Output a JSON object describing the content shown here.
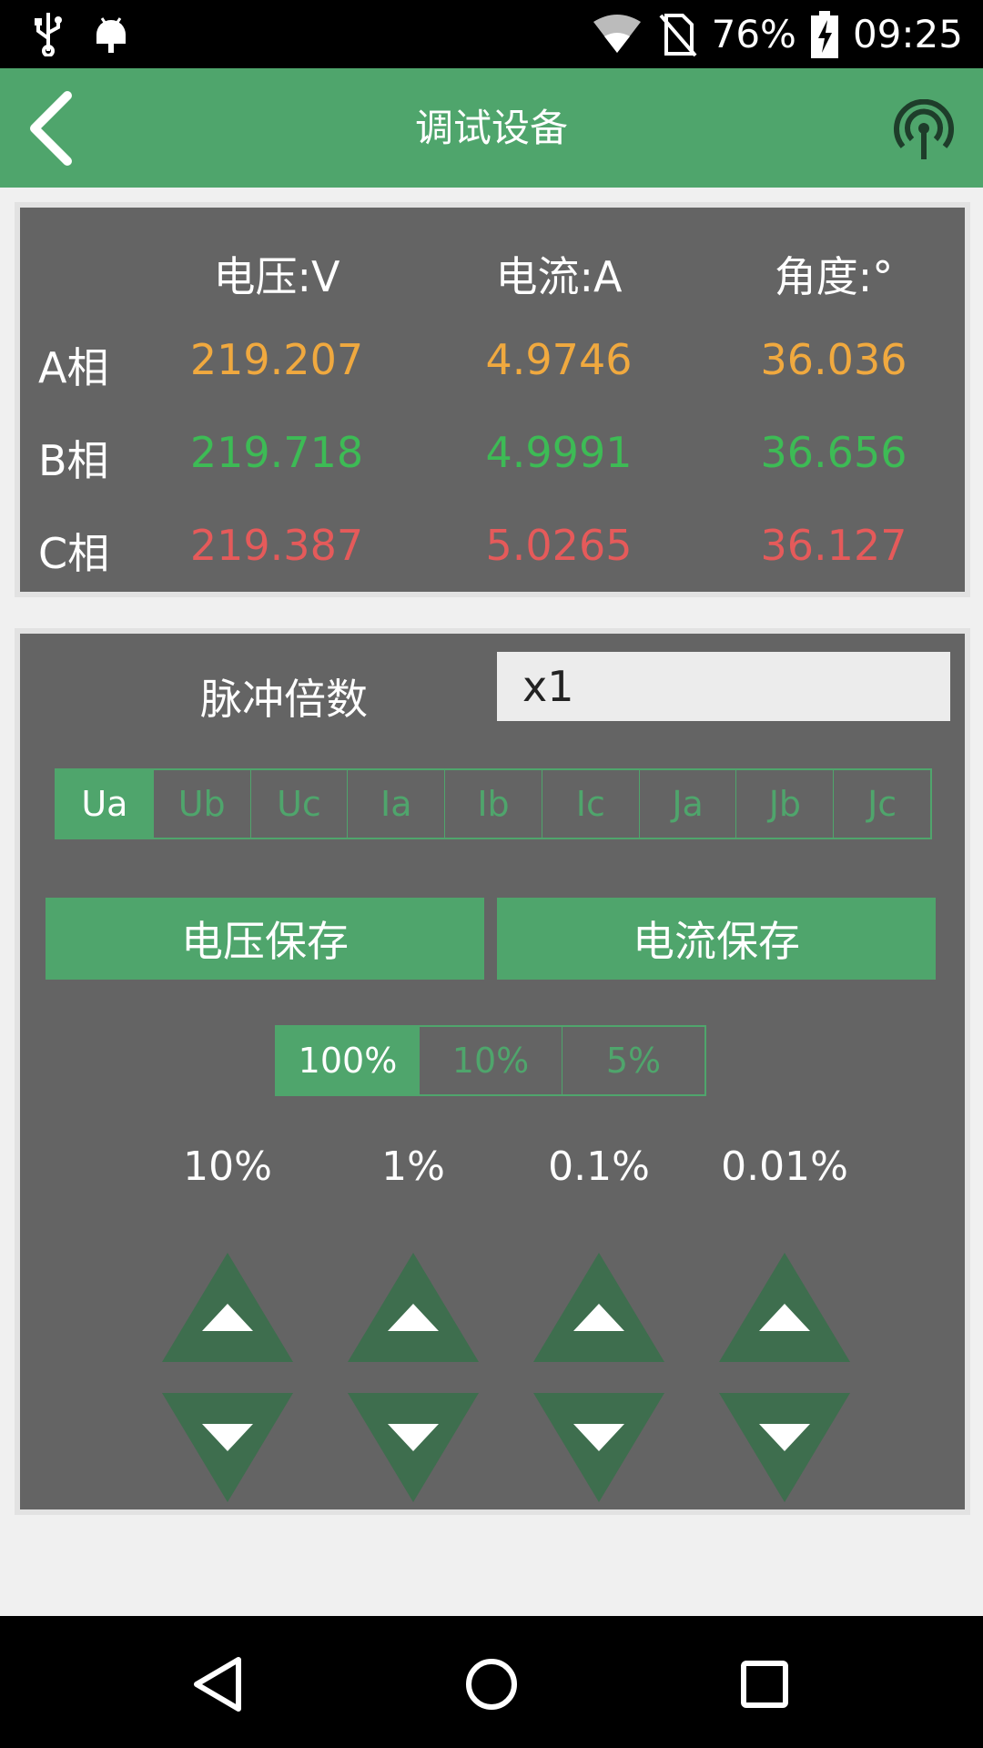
{
  "status_bar": {
    "battery": "76%",
    "time": "09:25",
    "icons": [
      "usb-icon",
      "android-debug-icon",
      "wifi-icon",
      "no-sim-icon",
      "battery-charging-icon"
    ]
  },
  "app_bar": {
    "title": "调试设备",
    "back_icon": "chevron-left-icon",
    "action_icon": "signal-broadcast-icon"
  },
  "readings": {
    "headers": [
      "电压:V",
      "电流:A",
      "角度:°"
    ],
    "rows": [
      {
        "phase": "A相",
        "voltage": "219.207",
        "current": "4.9746",
        "angle": "36.036",
        "color": "#f0a93f"
      },
      {
        "phase": "B相",
        "voltage": "219.718",
        "current": "4.9991",
        "angle": "36.656",
        "color": "#3dbb55"
      },
      {
        "phase": "C相",
        "voltage": "219.387",
        "current": "5.0265",
        "angle": "36.127",
        "color": "#e55a5a"
      }
    ]
  },
  "controls": {
    "pulse_label": "脉冲倍数",
    "pulse_value": "x1",
    "channels": [
      "Ua",
      "Ub",
      "Uc",
      "Ia",
      "Ib",
      "Ic",
      "Ja",
      "Jb",
      "Jc"
    ],
    "selected_channel": "Ua",
    "save_voltage": "电压保存",
    "save_current": "电流保存",
    "ranges": [
      "100%",
      "10%",
      "5%"
    ],
    "selected_range": "100%",
    "steps": [
      "10%",
      "1%",
      "0.1%",
      "0.01%"
    ]
  },
  "colors": {
    "accent": "#4fa56c",
    "panel": "#646464",
    "arrow": "#3e6e4e"
  }
}
